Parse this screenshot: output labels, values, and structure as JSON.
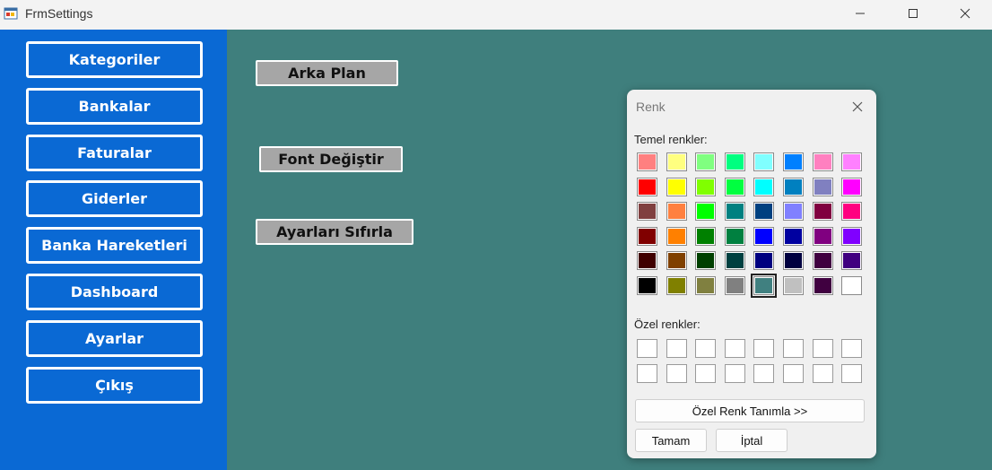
{
  "window": {
    "title": "FrmSettings",
    "minimize_icon": "minimize-icon",
    "maximize_icon": "maximize-icon",
    "close_icon": "close-icon"
  },
  "sidebar": {
    "background": "#0a69d4",
    "items": [
      {
        "label": "Kategoriler"
      },
      {
        "label": "Bankalar"
      },
      {
        "label": "Faturalar"
      },
      {
        "label": "Giderler"
      },
      {
        "label": "Banka Hareketleri"
      },
      {
        "label": "Dashboard"
      },
      {
        "label": "Ayarlar"
      },
      {
        "label": "Çıkış"
      }
    ]
  },
  "main": {
    "background": "#3f7f7d",
    "buttons": [
      {
        "label": "Arka Plan"
      },
      {
        "label": "Font Değiştir"
      },
      {
        "label": "Ayarları Sıfırla"
      }
    ]
  },
  "color_dialog": {
    "title": "Renk",
    "basic_colors_label": "Temel renkler:",
    "custom_colors_label": "Özel renkler:",
    "define_custom_button": "Özel Renk Tanımla >>",
    "ok_button": "Tamam",
    "cancel_button": "İptal",
    "selected_color": "#408080",
    "basic_colors": [
      [
        "#ff8080",
        "#ffff80",
        "#80ff80",
        "#00ff80",
        "#80ffff",
        "#0080ff",
        "#ff80c0",
        "#ff80ff"
      ],
      [
        "#ff0000",
        "#ffff00",
        "#80ff00",
        "#00ff40",
        "#00ffff",
        "#0080c0",
        "#8080c0",
        "#ff00ff"
      ],
      [
        "#804040",
        "#ff8040",
        "#00ff00",
        "#008080",
        "#004080",
        "#8080ff",
        "#800040",
        "#ff0080"
      ],
      [
        "#800000",
        "#ff8000",
        "#008000",
        "#008040",
        "#0000ff",
        "#0000a0",
        "#800080",
        "#8000ff"
      ],
      [
        "#400000",
        "#804000",
        "#004000",
        "#004040",
        "#000080",
        "#000040",
        "#400040",
        "#400080"
      ],
      [
        "#000000",
        "#808000",
        "#808040",
        "#808080",
        "#408080",
        "#c0c0c0",
        "#400040",
        "#ffffff"
      ]
    ],
    "custom_colors": [
      [
        "#ffffff",
        "#ffffff",
        "#ffffff",
        "#ffffff",
        "#ffffff",
        "#ffffff",
        "#ffffff",
        "#ffffff"
      ],
      [
        "#ffffff",
        "#ffffff",
        "#ffffff",
        "#ffffff",
        "#ffffff",
        "#ffffff",
        "#ffffff",
        "#ffffff"
      ]
    ]
  }
}
